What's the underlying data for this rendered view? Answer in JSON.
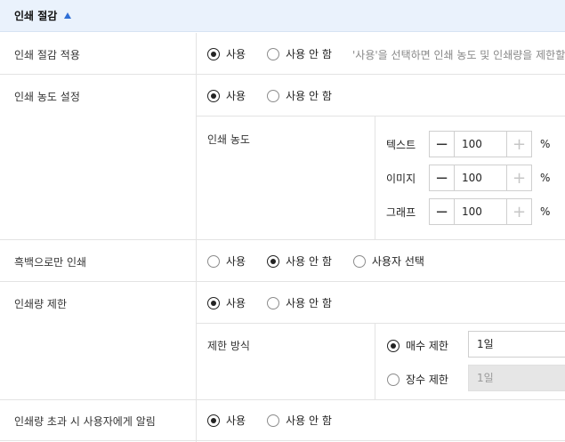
{
  "section": {
    "title": "인쇄 절감"
  },
  "rows": {
    "apply": {
      "label": "인쇄 절감 적용",
      "options": [
        "사용",
        "사용 안 함"
      ],
      "selected": 0,
      "hint": "'사용'을 선택하면 인쇄 농도 및 인쇄량을 제한할"
    },
    "density": {
      "label": "인쇄 농도 설정",
      "options": [
        "사용",
        "사용 안 함"
      ],
      "selected": 0,
      "sub_label": "인쇄 농도",
      "items": [
        {
          "label": "텍스트",
          "value": "100",
          "unit": "%"
        },
        {
          "label": "이미지",
          "value": "100",
          "unit": "%"
        },
        {
          "label": "그래프",
          "value": "100",
          "unit": "%"
        }
      ]
    },
    "mono": {
      "label": "흑백으로만 인쇄",
      "options": [
        "사용",
        "사용 안 함",
        "사용자 선택"
      ],
      "selected": 1
    },
    "limit": {
      "label": "인쇄량 제한",
      "options": [
        "사용",
        "사용 안 함"
      ],
      "selected": 0,
      "sub_label": "제한 방식",
      "methods": [
        {
          "label": "매수 제한",
          "value": "1일",
          "checked": true,
          "disabled": false
        },
        {
          "label": "장수 제한",
          "value": "1일",
          "checked": false,
          "disabled": true
        }
      ]
    },
    "notify": {
      "label": "인쇄량 초과 시 사용자에게 알림",
      "options": [
        "사용",
        "사용 안 함"
      ],
      "selected": 0
    }
  }
}
